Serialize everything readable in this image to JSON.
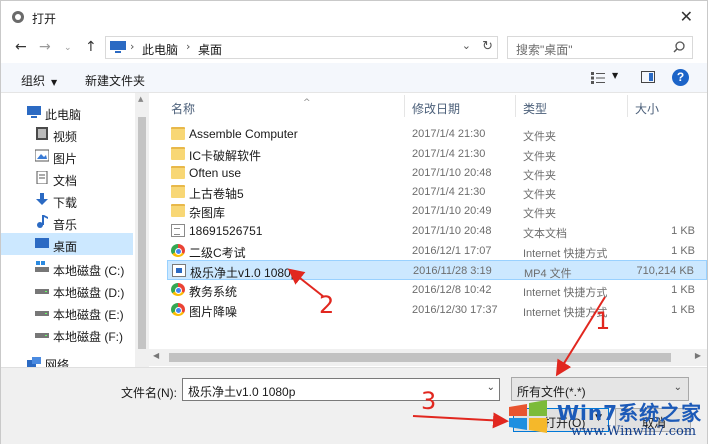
{
  "window": {
    "title": "打开"
  },
  "address": {
    "crumbs": [
      "此电脑",
      "桌面"
    ],
    "search_placeholder": "搜索\"桌面\""
  },
  "toolbar": {
    "organize": "组织",
    "new_folder": "新建文件夹"
  },
  "nav_items": [
    {
      "label": "此电脑",
      "icon": "computer-icon"
    },
    {
      "label": "视频",
      "icon": "video-folder-icon"
    },
    {
      "label": "图片",
      "icon": "picture-folder-icon"
    },
    {
      "label": "文档",
      "icon": "document-folder-icon"
    },
    {
      "label": "下载",
      "icon": "download-arrow-icon"
    },
    {
      "label": "音乐",
      "icon": "music-note-icon"
    },
    {
      "label": "桌面",
      "icon": "desktop-icon",
      "selected": true
    },
    {
      "label": "本地磁盘 (C:)",
      "icon": "drive-icon"
    },
    {
      "label": "本地磁盘 (D:)",
      "icon": "drive-icon"
    },
    {
      "label": "本地磁盘 (E:)",
      "icon": "drive-icon"
    },
    {
      "label": "本地磁盘 (F:)",
      "icon": "drive-icon"
    },
    {
      "label": "网络",
      "icon": "network-icon"
    }
  ],
  "columns": {
    "name": "名称",
    "date": "修改日期",
    "type": "类型",
    "size": "大小"
  },
  "files": [
    {
      "name": "Assemble Computer",
      "date": "2017/1/4 21:30",
      "type": "文件夹",
      "size": "",
      "icon": "folder-icon"
    },
    {
      "name": "IC卡破解软件",
      "date": "2017/1/4 21:30",
      "type": "文件夹",
      "size": "",
      "icon": "folder-icon"
    },
    {
      "name": "Often use",
      "date": "2017/1/10 20:48",
      "type": "文件夹",
      "size": "",
      "icon": "folder-icon"
    },
    {
      "name": "上古卷轴5",
      "date": "2017/1/4 21:30",
      "type": "文件夹",
      "size": "",
      "icon": "folder-icon"
    },
    {
      "name": "杂图库",
      "date": "2017/1/10 20:49",
      "type": "文件夹",
      "size": "",
      "icon": "folder-icon"
    },
    {
      "name": "18691526751",
      "date": "2017/1/10 20:48",
      "type": "文本文档",
      "size": "1 KB",
      "icon": "text-file-icon"
    },
    {
      "name": "二级C考试",
      "date": "2016/12/1 17:07",
      "type": "Internet 快捷方式",
      "size": "1 KB",
      "icon": "internet-shortcut-icon"
    },
    {
      "name": "极乐净土v1.0 1080p",
      "date": "2016/11/28 3:19",
      "type": "MP4 文件",
      "size": "710,214 KB",
      "icon": "mp4-file-icon",
      "selected": true
    },
    {
      "name": "教务系统",
      "date": "2016/12/8 10:42",
      "type": "Internet 快捷方式",
      "size": "1 KB",
      "icon": "internet-shortcut-icon"
    },
    {
      "name": "图片降噪",
      "date": "2016/12/30 17:37",
      "type": "Internet 快捷方式",
      "size": "1 KB",
      "icon": "internet-shortcut-icon"
    }
  ],
  "bottom": {
    "filename_label": "文件名(N):",
    "filename_value": "极乐净土v1.0 1080p",
    "filetype_value": "所有文件(*.*)",
    "open_label": "打开(O)",
    "cancel_label": "取消"
  },
  "annotations": [
    "1",
    "2",
    "3"
  ],
  "annotation_color": "#e1271f",
  "watermark": {
    "title": "Win7系统之家",
    "url": "www.Winwin7.com"
  }
}
